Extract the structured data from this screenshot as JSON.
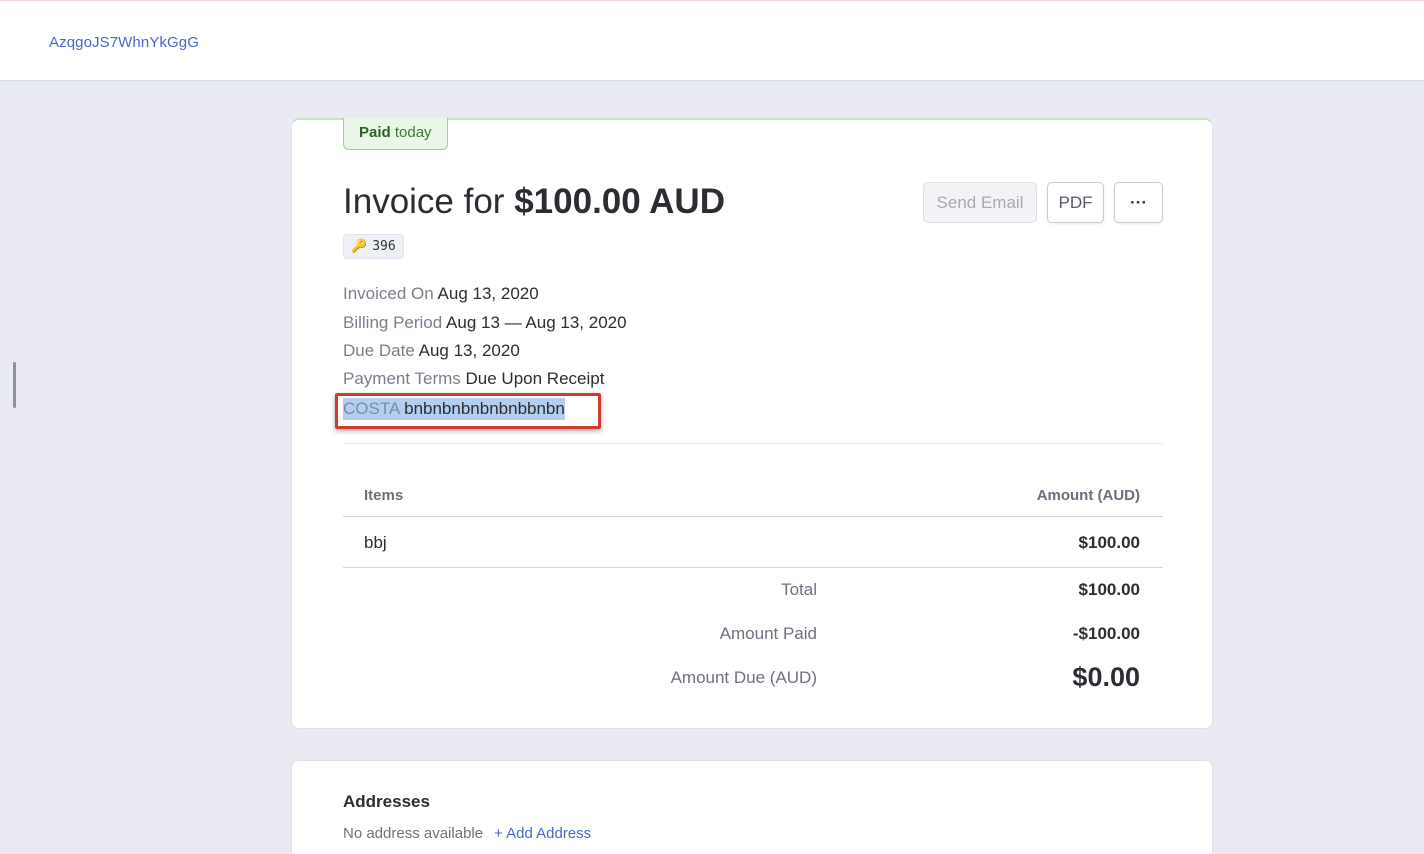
{
  "header": {
    "account_id": "AzqgoJS7WhnYkGgG"
  },
  "invoice": {
    "status": {
      "label": "Paid",
      "when": "today"
    },
    "title_prefix": "Invoice for",
    "title_amount": "$100.00 AUD",
    "actions": {
      "send_email": "Send Email",
      "pdf": "PDF",
      "more": "···"
    },
    "key_chip": {
      "icon": "key-icon",
      "value": "396"
    },
    "meta": [
      {
        "label": "Invoiced On",
        "value": "Aug 13, 2020"
      },
      {
        "label": "Billing Period",
        "value": "Aug 13 — Aug 13, 2020"
      },
      {
        "label": "Due Date",
        "value": "Aug 13, 2020"
      },
      {
        "label": "Payment Terms",
        "value": "Due Upon Receipt"
      },
      {
        "label": "COSTA",
        "value": "bnbnbnbnbnbnbbnbn"
      }
    ],
    "table": {
      "headers": {
        "items": "Items",
        "amount": "Amount (AUD)"
      },
      "rows": [
        {
          "name": "bbj",
          "amount": "$100.00"
        }
      ]
    },
    "summary": [
      {
        "label": "Total",
        "value": "$100.00"
      },
      {
        "label": "Amount Paid",
        "value": "-$100.00"
      },
      {
        "label": "Amount Due (AUD)",
        "value": "$0.00"
      }
    ]
  },
  "addresses": {
    "title": "Addresses",
    "empty_text": "No address available",
    "add_link": "+ Add Address"
  },
  "colors": {
    "accent": "#4a66c9",
    "paid_green": "#3c7a37",
    "highlight_box": "#d23c2f"
  }
}
